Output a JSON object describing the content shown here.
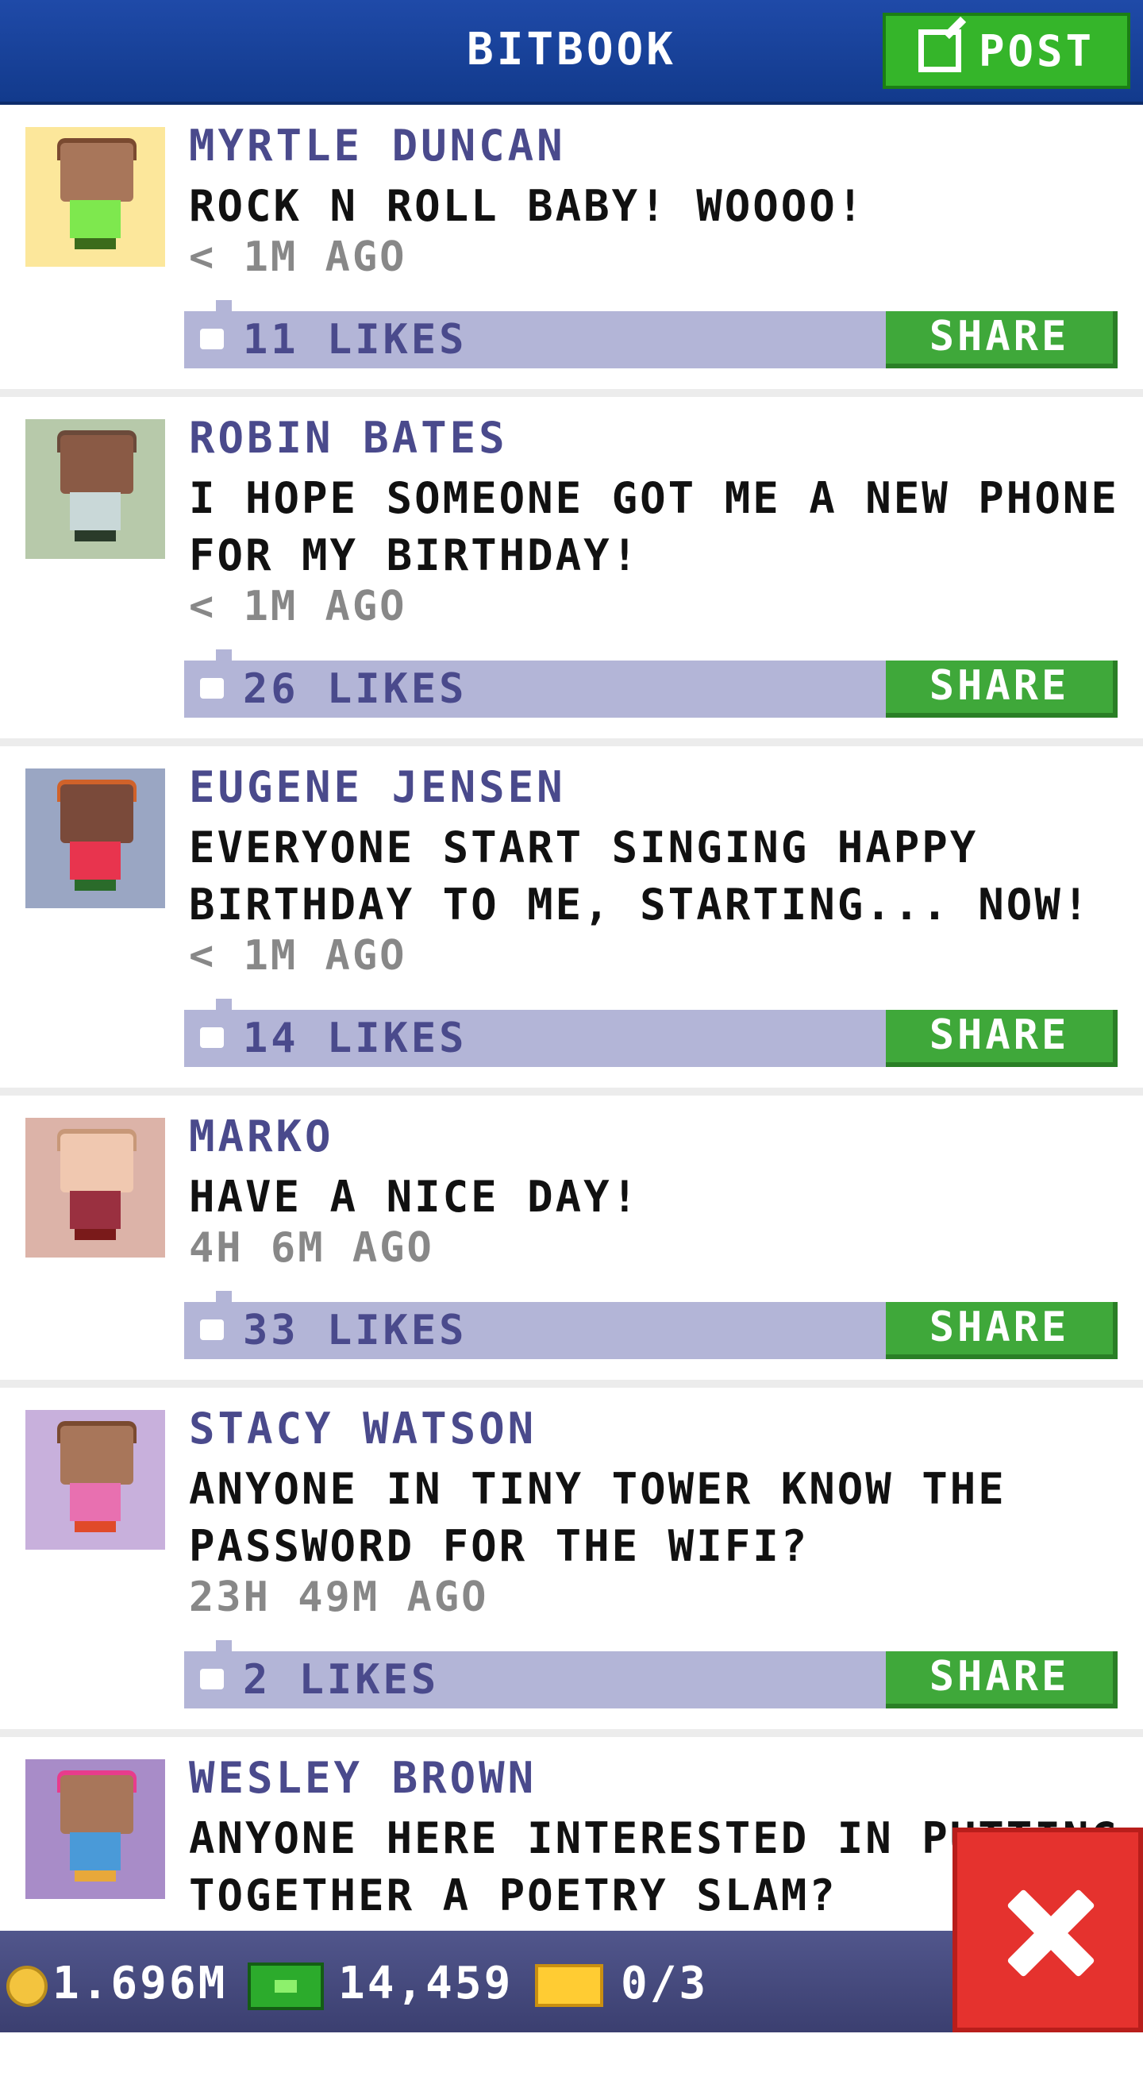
{
  "header": {
    "title": "BITBOOK",
    "post_label": "POST"
  },
  "posts": [
    {
      "name": "MYRTLE DUNCAN",
      "message": "ROCK N ROLL BABY! WOOOO!",
      "time": "< 1M AGO",
      "likes": "11 LIKES",
      "share_label": "SHARE",
      "avatar": {
        "bg": "#fce79b",
        "skin": "#a8765a",
        "hair": "#7a4a30",
        "shirt": "#7ee84e",
        "legs": "#3b6b1b"
      }
    },
    {
      "name": "ROBIN BATES",
      "message": "I HOPE SOMEONE GOT ME A NEW PHONE FOR MY BIRTHDAY!",
      "time": "< 1M AGO",
      "likes": "26 LIKES",
      "share_label": "SHARE",
      "avatar": {
        "bg": "#b7c9aa",
        "skin": "#8a5a45",
        "hair": "#6b4a3a",
        "shirt": "#c9d8d8",
        "legs": "#2a3b2a"
      }
    },
    {
      "name": "EUGENE JENSEN",
      "message": "EVERYONE START SINGING HAPPY BIRTHDAY TO ME, STARTING... NOW!",
      "time": "< 1M AGO",
      "likes": "14 LIKES",
      "share_label": "SHARE",
      "avatar": {
        "bg": "#9aa6c3",
        "skin": "#7a4a3a",
        "hair": "#d0622a",
        "shirt": "#e8344e",
        "legs": "#2a6b2a"
      }
    },
    {
      "name": "MARKO",
      "message": "HAVE A NICE DAY!",
      "time": "4H 6M AGO",
      "likes": "33 LIKES",
      "share_label": "SHARE",
      "avatar": {
        "bg": "#dcb3a8",
        "skin": "#f0c8b0",
        "hair": "#c89878",
        "shirt": "#9a3040",
        "legs": "#7a1a1a"
      }
    },
    {
      "name": "STACY WATSON",
      "message": "ANYONE IN TINY TOWER KNOW THE PASSWORD FOR THE WIFI?",
      "time": "23H 49M AGO",
      "likes": "2 LIKES",
      "share_label": "SHARE",
      "avatar": {
        "bg": "#c8b0dc",
        "skin": "#a8765a",
        "hair": "#7a4a30",
        "shirt": "#e870b0",
        "legs": "#e04a2a"
      }
    },
    {
      "name": "WESLEY BROWN",
      "message": "ANYONE HERE INTERESTED IN PUTTING TOGETHER A POETRY SLAM?",
      "avatar": {
        "bg": "#a88cc8",
        "skin": "#a8765a",
        "hair": "#e83c8c",
        "shirt": "#4a9ad8",
        "legs": "#e8a83a"
      }
    }
  ],
  "footer": {
    "coins": "1.696M",
    "bux": "14,459",
    "tickets": "0/3"
  },
  "colors": {
    "header": "#1f4aa8",
    "accent_green": "#35b52a",
    "likes_bar": "#b3b5d7",
    "close_red": "#e5322e"
  },
  "icons": {
    "post": "edit-icon",
    "like": "thumbs-up-icon",
    "coin": "coin-icon",
    "bux": "bux-icon",
    "ticket": "ticket-icon",
    "close": "close-icon"
  }
}
